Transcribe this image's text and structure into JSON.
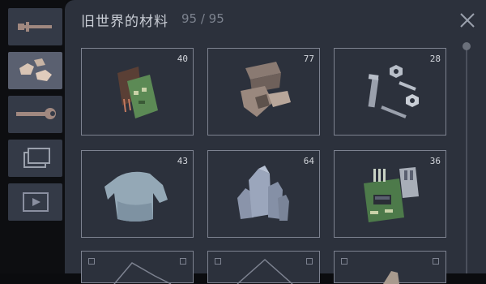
{
  "header": {
    "title": "旧世界的材料",
    "count": "95 / 95"
  },
  "sidebar": {
    "tabs": [
      {
        "icon": "sword-icon",
        "active": false
      },
      {
        "icon": "rocks-icon",
        "active": true
      },
      {
        "icon": "wrench-icon",
        "active": false
      },
      {
        "icon": "windows-icon",
        "active": false
      },
      {
        "icon": "play-video-icon",
        "active": false
      }
    ]
  },
  "items": [
    {
      "icon": "circuit-board-icon",
      "count": "40"
    },
    {
      "icon": "scrap-metal-icon",
      "count": "77"
    },
    {
      "icon": "bolts-screws-icon",
      "count": "28"
    },
    {
      "icon": "cloth-shirt-icon",
      "count": "43"
    },
    {
      "icon": "crystal-rocks-icon",
      "count": "64"
    },
    {
      "icon": "electronic-chip-icon",
      "count": "36"
    }
  ],
  "colors": {
    "panel": "#2c313c",
    "slot_border": "#7d8290",
    "sidebar_tab": "#343a47",
    "sidebar_tab_active": "#5a6070"
  }
}
